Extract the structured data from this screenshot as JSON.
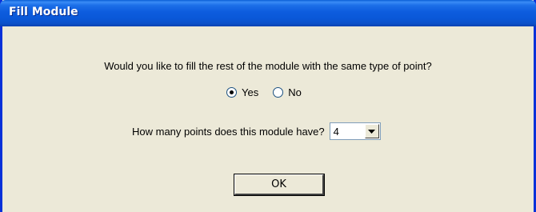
{
  "window": {
    "title": "Fill Module"
  },
  "dialog": {
    "question": "Would you like to fill the rest of the module with the same type of point?",
    "options": [
      {
        "label": "Yes",
        "selected": true
      },
      {
        "label": "No",
        "selected": false
      }
    ],
    "points_label": "How many points does this module have?",
    "points_value": "4",
    "ok_label": "OK"
  },
  "colors": {
    "titlebar": "#0a58d8",
    "dialog_bg": "#ece9d8",
    "frame": "#0831d9"
  }
}
